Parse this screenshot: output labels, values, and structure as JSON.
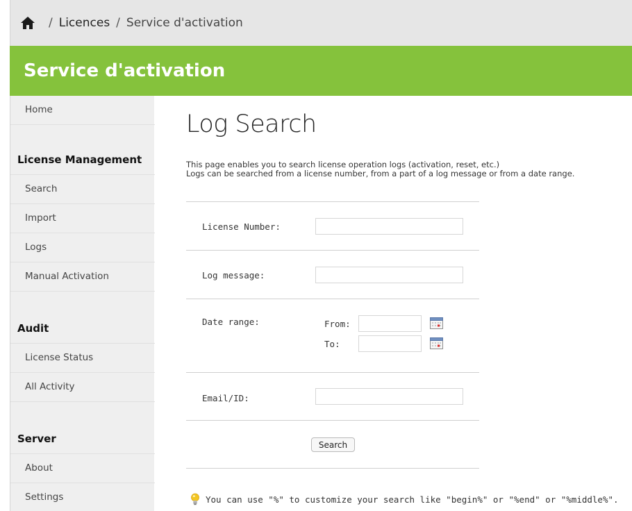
{
  "breadcrumb": {
    "home_icon": "home-icon",
    "separator": "/",
    "items": [
      "Licences",
      "Service d'activation"
    ]
  },
  "banner": {
    "title": "Service d'activation"
  },
  "sidebar": {
    "home": "Home",
    "license_management": {
      "heading": "License Management",
      "items": [
        "Search",
        "Import",
        "Logs",
        "Manual Activation"
      ]
    },
    "audit": {
      "heading": "Audit",
      "items": [
        "License Status",
        "All Activity"
      ]
    },
    "server": {
      "heading": "Server",
      "items": [
        "About",
        "Settings"
      ]
    }
  },
  "main": {
    "title": "Log Search",
    "description": [
      "This page enables you to search license operation logs (activation, reset, etc.)",
      "Logs can be searched from a license number, from a part of a log message or from a date range."
    ],
    "form": {
      "license_number": {
        "label": "License Number:",
        "value": ""
      },
      "log_message": {
        "label": "Log message:",
        "value": ""
      },
      "date_range": {
        "label": "Date range:",
        "from_label": "From:",
        "to_label": "To:",
        "from_value": "",
        "to_value": "",
        "calendar_icon": "calendar-icon"
      },
      "email_id": {
        "label": "Email/ID:",
        "value": ""
      },
      "search_button": "Search"
    },
    "hint": {
      "icon": "lightbulb-icon",
      "text": "You can use \"%\" to customize your search like \"begin%\" or \"%end\" or \"%middle%\"."
    }
  },
  "colors": {
    "banner": "#85c23c",
    "sidebar": "#efefef",
    "breadcrumb_bar": "#e6e6e6"
  }
}
